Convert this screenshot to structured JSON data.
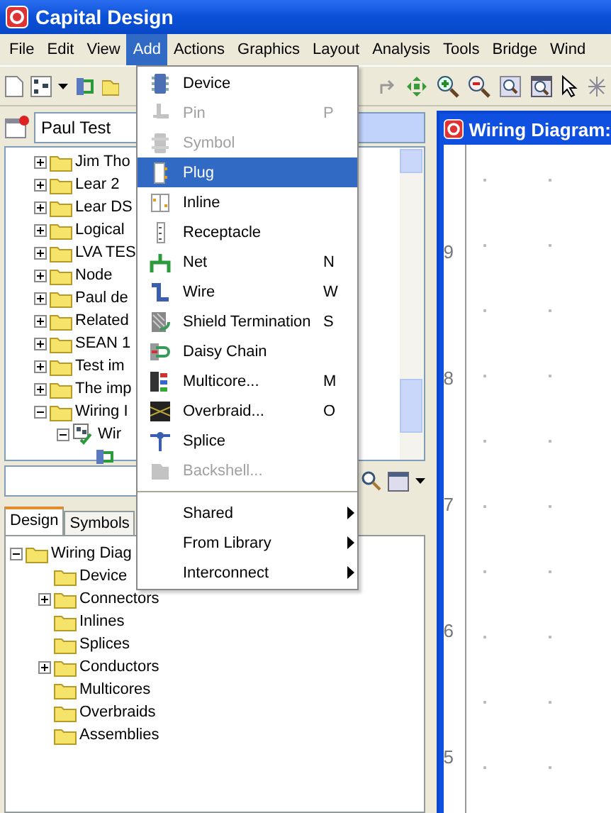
{
  "window": {
    "title": "Capital Design"
  },
  "menu_bar": [
    {
      "label": "File",
      "selected": false
    },
    {
      "label": "Edit",
      "selected": false
    },
    {
      "label": "View",
      "selected": false
    },
    {
      "label": "Add",
      "selected": true
    },
    {
      "label": "Actions",
      "selected": false
    },
    {
      "label": "Graphics",
      "selected": false
    },
    {
      "label": "Layout",
      "selected": false
    },
    {
      "label": "Analysis",
      "selected": false
    },
    {
      "label": "Tools",
      "selected": false
    },
    {
      "label": "Bridge",
      "selected": false
    },
    {
      "label": "Wind",
      "selected": false
    }
  ],
  "project_selector": {
    "value": "Paul Test"
  },
  "project_tree": [
    {
      "kind": "folder",
      "label": "Jim Tho",
      "expanded": false
    },
    {
      "kind": "folder",
      "label": "Lear 2",
      "expanded": false
    },
    {
      "kind": "folder",
      "label": "Lear DS",
      "expanded": false
    },
    {
      "kind": "folder",
      "label": "Logical",
      "expanded": false
    },
    {
      "kind": "folder",
      "label": "LVA TES",
      "expanded": false
    },
    {
      "kind": "folder",
      "label": "Node",
      "expanded": false
    },
    {
      "kind": "folder",
      "label": "Paul de",
      "expanded": false
    },
    {
      "kind": "folder",
      "label": "Related",
      "expanded": false
    },
    {
      "kind": "folder",
      "label": "SEAN 1",
      "expanded": false
    },
    {
      "kind": "folder",
      "label": "Test im",
      "expanded": false
    },
    {
      "kind": "folder",
      "label": "The imp",
      "expanded": false
    },
    {
      "kind": "folder",
      "label": "Wiring I",
      "expanded": true,
      "children": [
        {
          "kind": "design",
          "label": "Wir",
          "expanded": true,
          "children": [
            {
              "kind": "diagram"
            }
          ]
        }
      ]
    }
  ],
  "panel_tabs": [
    {
      "label": "Design",
      "selected": true
    },
    {
      "label": "Symbols",
      "selected": false
    }
  ],
  "design_tree": {
    "label": "Wiring Diag",
    "expanded": true,
    "children": [
      {
        "kind": "leaf",
        "label": "Device"
      },
      {
        "kind": "expandable",
        "label": "Connectors",
        "expanded": false
      },
      {
        "kind": "leaf",
        "label": "Inlines"
      },
      {
        "kind": "leaf",
        "label": "Splices"
      },
      {
        "kind": "expandable",
        "label": "Conductors",
        "expanded": false
      },
      {
        "kind": "leaf",
        "label": "Multicores"
      },
      {
        "kind": "leaf",
        "label": "Overbraids"
      },
      {
        "kind": "leaf",
        "label": "Assemblies"
      }
    ]
  },
  "diagram_window": {
    "title": "Wiring Diagram:",
    "ruler_labels": [
      "9",
      "8",
      "7",
      "6",
      "5"
    ]
  },
  "add_menu": [
    {
      "kind": "item",
      "label": "Device",
      "disabled": false,
      "selected": false
    },
    {
      "kind": "item",
      "label": "Pin",
      "shortcut": "P",
      "disabled": true,
      "selected": false
    },
    {
      "kind": "item",
      "label": "Symbol",
      "disabled": true,
      "selected": false
    },
    {
      "kind": "item",
      "label": "Plug",
      "disabled": false,
      "selected": true
    },
    {
      "kind": "item",
      "label": "Inline",
      "disabled": false,
      "selected": false
    },
    {
      "kind": "item",
      "label": "Receptacle",
      "disabled": false,
      "selected": false
    },
    {
      "kind": "item",
      "label": "Net",
      "shortcut": "N",
      "disabled": false,
      "selected": false
    },
    {
      "kind": "item",
      "label": "Wire",
      "shortcut": "W",
      "disabled": false,
      "selected": false
    },
    {
      "kind": "item",
      "label": "Shield Termination",
      "shortcut": "S",
      "disabled": false,
      "selected": false
    },
    {
      "kind": "item",
      "label": "Daisy Chain",
      "disabled": false,
      "selected": false
    },
    {
      "kind": "item",
      "label": "Multicore...",
      "shortcut": "M",
      "disabled": false,
      "selected": false
    },
    {
      "kind": "item",
      "label": "Overbraid...",
      "shortcut": "O",
      "disabled": false,
      "selected": false
    },
    {
      "kind": "item",
      "label": "Splice",
      "disabled": false,
      "selected": false
    },
    {
      "kind": "item",
      "label": "Backshell...",
      "disabled": true,
      "selected": false
    },
    {
      "kind": "separator"
    },
    {
      "kind": "submenu",
      "label": "Shared",
      "disabled": false,
      "selected": false
    },
    {
      "kind": "submenu",
      "label": "From Library",
      "disabled": false,
      "selected": false
    },
    {
      "kind": "submenu",
      "label": "Interconnect",
      "disabled": false,
      "selected": false
    }
  ]
}
